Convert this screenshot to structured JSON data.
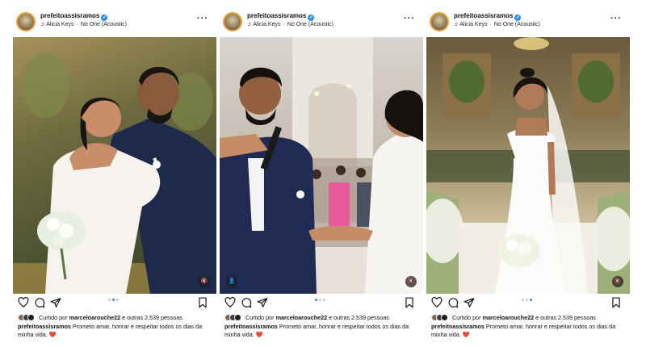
{
  "posts": [
    {
      "username": "prefeitoassisramos",
      "audio_artist": "Alicia Keys",
      "audio_track": "No One (Acoustic)",
      "liked_by_prefix": "Curtido por",
      "liked_by_user": "marceloarouche22",
      "liked_by_suffix": "e outras 2.539 pessoas",
      "caption_user": "prefeitoassisramos",
      "caption_text": "Prometo amar, honrar e respeitar todos os dias da minha vida.",
      "caption_emoji": "❤️",
      "active_dot": 1
    },
    {
      "username": "prefeitoassisramos",
      "audio_artist": "Alicia Keys",
      "audio_track": "No One (Acoustic)",
      "liked_by_prefix": "Curtido por",
      "liked_by_user": "marceloarouche22",
      "liked_by_suffix": "e outras 2.539 pessoas",
      "caption_user": "prefeitoassisramos",
      "caption_text": "Prometo amar, honrar e respeitar todos os dias da minha vida.",
      "caption_emoji": "❤️",
      "active_dot": 0
    },
    {
      "username": "prefeitoassisramos",
      "audio_artist": "Alicia Keys",
      "audio_track": "No One (Acoustic)",
      "liked_by_prefix": "Curtido por",
      "liked_by_user": "marceloarouche22",
      "liked_by_suffix": "e outras 2.539 pessoas",
      "caption_user": "prefeitoassisramos",
      "caption_text": "Prometo amar, honrar e respeitar todos os dias da minha vida.",
      "caption_emoji": "❤️",
      "active_dot": 2
    }
  ],
  "icons": {
    "verified": "verified-badge-icon",
    "music": "music-note-icon",
    "more": "more-options-icon",
    "like": "heart-icon",
    "comment": "comment-icon",
    "share": "send-icon",
    "save": "bookmark-icon",
    "mute": "muted-speaker-icon",
    "tagged": "tagged-user-icon"
  },
  "colors": {
    "accent": "#2f8cf0",
    "heart": "#e2264d",
    "story_ring": "#e9a23b"
  },
  "glyphs": {
    "more": "···",
    "verified": "✓",
    "music": "♫",
    "dot_sep": "·",
    "mute": "🔇",
    "tagged": "👤"
  }
}
